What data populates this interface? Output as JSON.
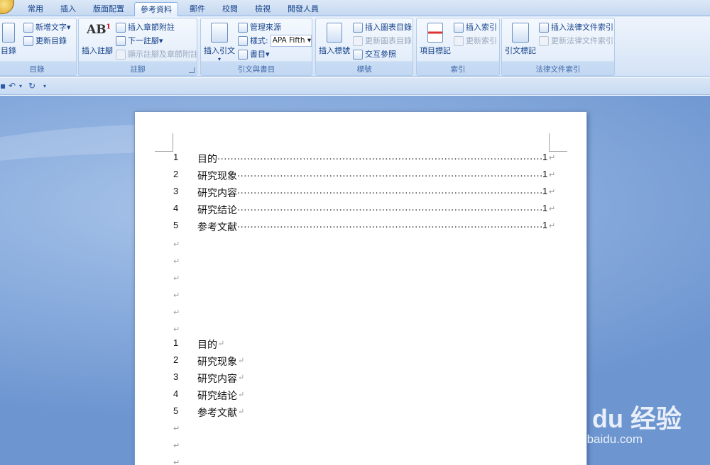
{
  "tabs": [
    "常用",
    "插入",
    "版面配置",
    "參考資料",
    "郵件",
    "校閱",
    "檢視",
    "開發人員"
  ],
  "active_tab": "參考資料",
  "ribbon": {
    "toc_group": {
      "label": "目錄",
      "big": "目錄",
      "add_text": "新增文字",
      "update": "更新目錄"
    },
    "footnote_group": {
      "label": "註腳",
      "big": "插入註腳",
      "insert_endnote": "插入章節附註",
      "next_footnote": "下一註腳",
      "show_notes": "顯示註腳及章節附註"
    },
    "citation_group": {
      "label": "引文與書目",
      "big": "插入引文",
      "manage_sources": "管理來源",
      "style_label": "樣式:",
      "style_value": "APA Fifth",
      "bibliography": "書目"
    },
    "caption_group": {
      "label": "標號",
      "big": "插入標號",
      "insert_table_of_figures": "插入圖表目錄",
      "update_table": "更新圖表目錄",
      "cross_reference": "交互參照"
    },
    "index_group": {
      "label": "索引",
      "big": "項目標記",
      "insert_index": "插入索引",
      "update_index": "更新索引"
    },
    "authorities_group": {
      "label": "法律文件索引",
      "big": "引文標記",
      "insert_table": "插入法律文件索引",
      "update_table": "更新法律文件索引"
    }
  },
  "document": {
    "toc": [
      {
        "num": "1",
        "text": "目的",
        "page": "1"
      },
      {
        "num": "2",
        "text": "研究现象",
        "page": "1"
      },
      {
        "num": "3",
        "text": "研究内容",
        "page": "1"
      },
      {
        "num": "4",
        "text": "研究结论",
        "page": "1"
      },
      {
        "num": "5",
        "text": "参考文献",
        "page": "1"
      }
    ],
    "headings": [
      {
        "num": "1",
        "text": "目的"
      },
      {
        "num": "2",
        "text": "研究现象"
      },
      {
        "num": "3",
        "text": "研究内容"
      },
      {
        "num": "4",
        "text": "研究结论"
      },
      {
        "num": "5",
        "text": "参考文献"
      }
    ],
    "para_mark": "↵",
    "dot_leader": "..........................................................................................................................................."
  },
  "watermark": {
    "main": "Bai du 经验",
    "sub": "jingyan.baidu.com"
  }
}
